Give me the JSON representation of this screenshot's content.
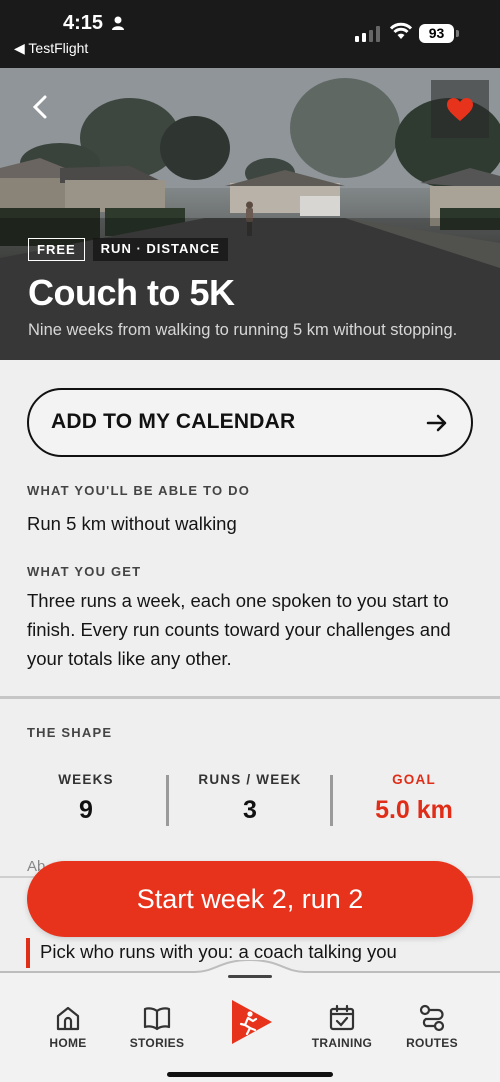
{
  "status_bar": {
    "time": "4:15",
    "back_app": "◀ TestFlight",
    "battery": "93"
  },
  "hero": {
    "tag_free": "FREE",
    "tag_category": "RUN · DISTANCE",
    "title": "Couch to 5K",
    "subtitle": "Nine weeks from walking to running 5 km without stopping."
  },
  "calendar_button": {
    "label": "ADD TO MY CALENDAR"
  },
  "able_to_do": {
    "label": "WHAT YOU'LL BE ABLE TO DO",
    "text": "Run 5 km without walking"
  },
  "what_you_get": {
    "label": "WHAT YOU GET",
    "text": "Three runs a week, each one spoken to you start to finish. Every run counts toward your challenges and your totals like any other."
  },
  "shape": {
    "label": "THE SHAPE",
    "stats": [
      {
        "label": "WEEKS",
        "value": "9"
      },
      {
        "label": "RUNS / WEEK",
        "value": "3"
      },
      {
        "label": "GOAL",
        "value": "5.0 km"
      }
    ]
  },
  "peek": {
    "partial_text": "Ab",
    "quote_text": "Pick who runs with you: a coach talking you"
  },
  "start_button": {
    "label": "Start week 2, run 2"
  },
  "tabs": [
    {
      "label": "HOME",
      "icon": "home-icon"
    },
    {
      "label": "STORIES",
      "icon": "book-icon"
    },
    {
      "label": "",
      "icon": "run-play-icon"
    },
    {
      "label": "TRAINING",
      "icon": "calendar-check-icon"
    },
    {
      "label": "ROUTES",
      "icon": "route-icon"
    }
  ],
  "colors": {
    "accent": "#e8331c",
    "dark": "#1b1a1a",
    "background": "#efefef"
  }
}
